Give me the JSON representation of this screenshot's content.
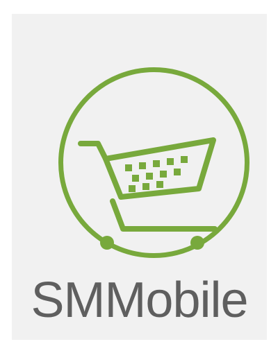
{
  "app": {
    "label": "SMMobile",
    "icon": "shopping-cart-icon",
    "accent_color": "#78a93c",
    "label_color": "#5f5f5f"
  }
}
